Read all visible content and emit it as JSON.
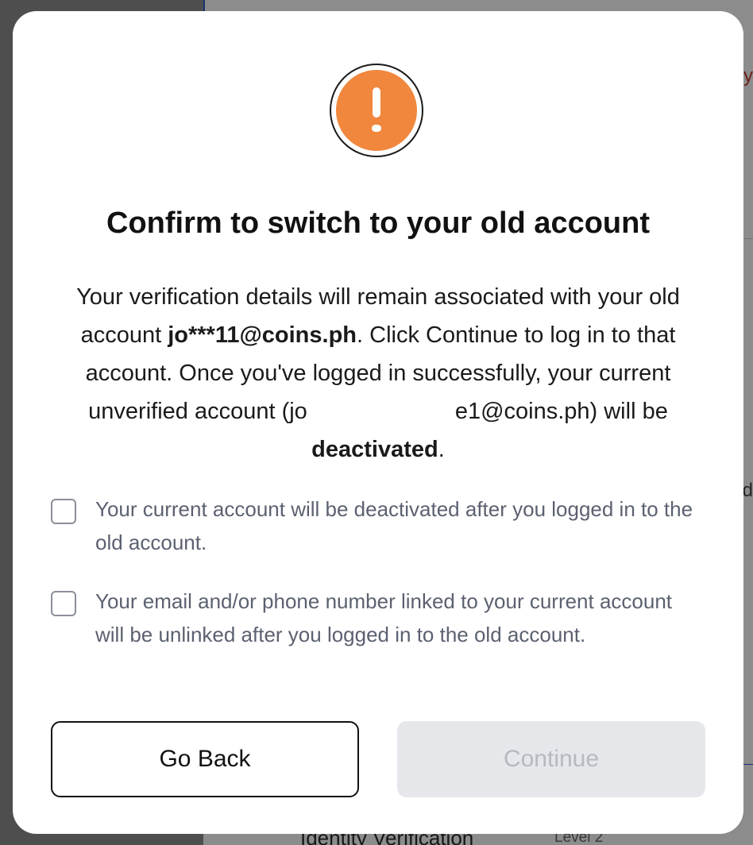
{
  "background": {
    "bottom_text": "Identity Verification",
    "bottom_level": "Level 2",
    "right_char_top": "y",
    "right_char_mid": "d"
  },
  "modal": {
    "icon": "exclamation-icon",
    "title": "Confirm to switch to your old account",
    "description": {
      "part1": "Your verification details will remain associated with your old account ",
      "old_account": "jo***11@coins.ph",
      "part2": ". Click Continue to log in to that account. Once you've logged in successfully, your current unverified account (jo",
      "current_account_suffix": "e1@coins.ph) will be ",
      "deactivated": "deactivated",
      "part3": "."
    },
    "checkboxes": [
      {
        "label": "Your current account will be deactivated after you logged in to the old account.",
        "checked": false
      },
      {
        "label": "Your email and/or phone number linked to your current account will be unlinked after you logged in to the old account.",
        "checked": false
      }
    ],
    "buttons": {
      "go_back": "Go Back",
      "continue": "Continue"
    }
  },
  "colors": {
    "accent_orange": "#f0873d",
    "disabled_bg": "#e6e7eb",
    "disabled_text": "#b6b9c1"
  }
}
